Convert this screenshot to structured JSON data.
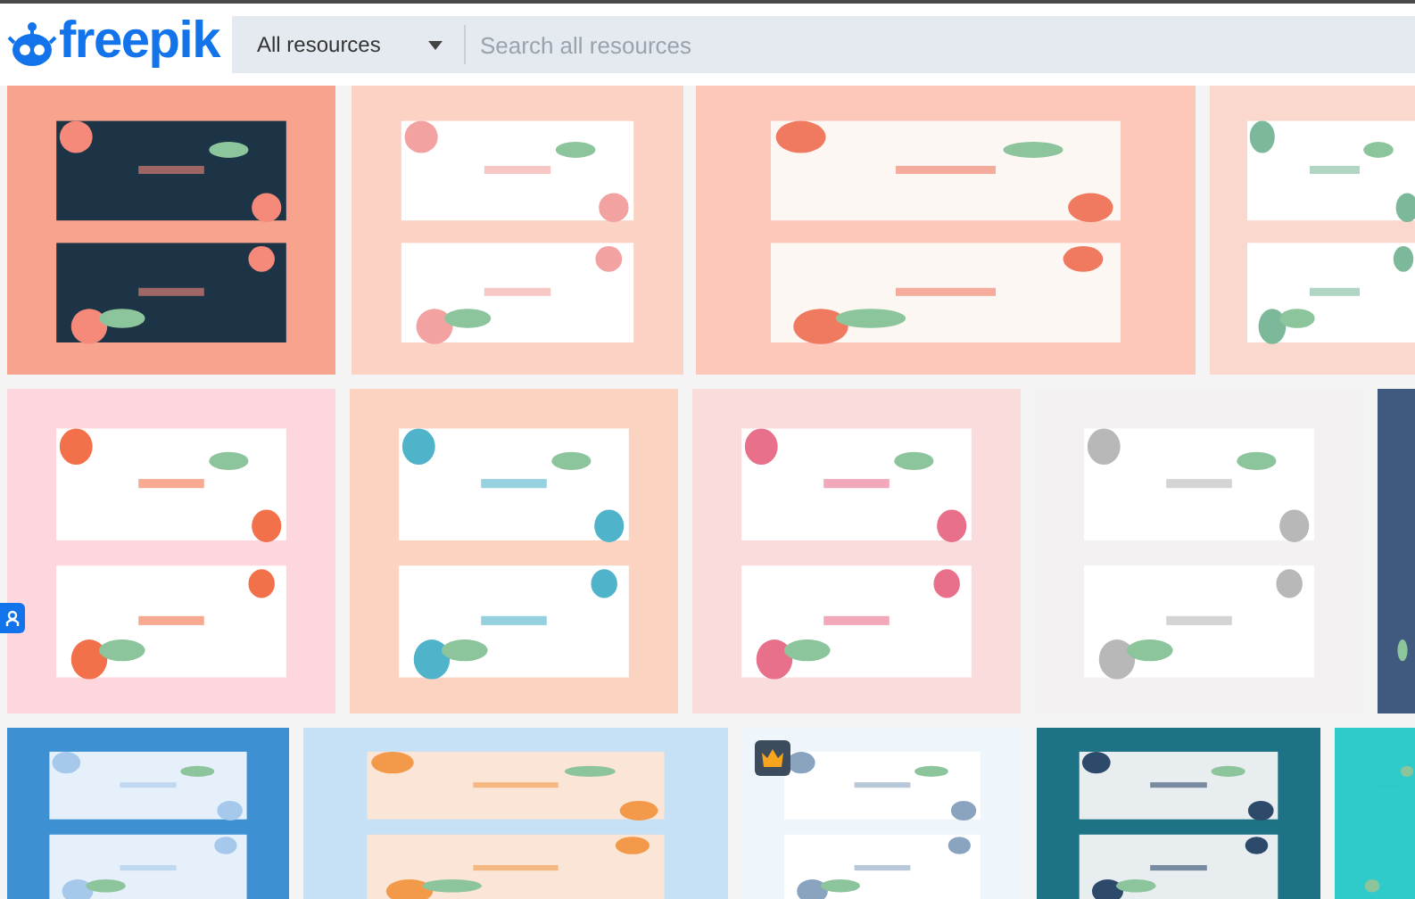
{
  "header": {
    "logo": "freepik",
    "filter": {
      "value": "All resources"
    },
    "search": {
      "placeholder": "Search all resources"
    }
  },
  "rows": [
    {
      "tiles": [
        {
          "kind": "picture",
          "premium": false
        },
        {
          "kind": "picture",
          "premium": false
        },
        {
          "kind": "picture",
          "premium": false
        },
        {
          "kind": "picture",
          "premium": false
        }
      ]
    },
    {
      "tiles": [
        {
          "kind": "picture",
          "premium": false
        },
        {
          "kind": "picture",
          "premium": false
        },
        {
          "kind": "picture",
          "premium": false
        },
        {
          "kind": "picture",
          "premium": false
        },
        {
          "kind": "picture",
          "premium": false
        }
      ]
    },
    {
      "tiles": [
        {
          "kind": "picture",
          "premium": false
        },
        {
          "kind": "picture",
          "premium": false
        },
        {
          "kind": "picture",
          "premium": true
        },
        {
          "kind": "picture",
          "premium": false
        },
        {
          "kind": "picture",
          "premium": false
        }
      ]
    }
  ]
}
